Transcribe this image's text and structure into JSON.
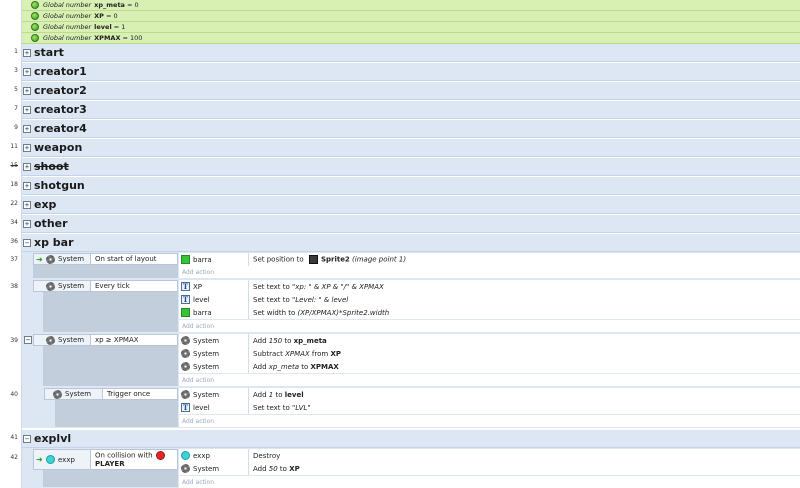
{
  "global_vars": [
    {
      "label": "Global number",
      "name": "xp_meta",
      "value": "= 0"
    },
    {
      "label": "Global number",
      "name": "XP",
      "value": "= 0"
    },
    {
      "label": "Global number",
      "name": "level",
      "value": "= 1"
    },
    {
      "label": "Global number",
      "name": "XPMAX",
      "value": "= 100"
    }
  ],
  "groups": [
    {
      "line": "1",
      "title": "start",
      "toggle": "+"
    },
    {
      "line": "3",
      "title": "creator1",
      "toggle": "+"
    },
    {
      "line": "5",
      "title": "creator2",
      "toggle": "+"
    },
    {
      "line": "7",
      "title": "creator3",
      "toggle": "+"
    },
    {
      "line": "9",
      "title": "creator4",
      "toggle": "+"
    },
    {
      "line": "11",
      "title": "weapon",
      "toggle": "+"
    },
    {
      "line": "15",
      "title": "shoot",
      "toggle": "+"
    },
    {
      "line": "18",
      "title": "shotgun",
      "toggle": "+"
    },
    {
      "line": "22",
      "title": "exp",
      "toggle": "+"
    },
    {
      "line": "34",
      "title": "other",
      "toggle": "+"
    },
    {
      "line": "36",
      "title": "xp bar",
      "toggle": "−"
    },
    {
      "line": "41",
      "title": "explvl",
      "toggle": "−"
    }
  ],
  "events": {
    "e37": {
      "line": "37",
      "obj": "System",
      "cond": "On start of layout",
      "a1": {
        "obj": "barra",
        "pre": "Set position to ",
        "obj2": "Sprite2",
        "post": " (image point 1)"
      },
      "add": "Add action"
    },
    "e38": {
      "line": "38",
      "obj": "System",
      "cond": "Every tick",
      "a1": {
        "obj": "XP",
        "pre": "Set text to ",
        "expr": "\"xp: \" & XP & \"/\" & XPMAX"
      },
      "a2": {
        "obj": "level",
        "pre": "Set text to ",
        "expr": "\"Level: \" & level"
      },
      "a3": {
        "obj": "barra",
        "pre": "Set width to ",
        "expr": "(XP/XPMAX)*Sprite2.width"
      },
      "add": "Add action"
    },
    "e39": {
      "line": "39",
      "toggle": "−",
      "obj": "System",
      "cond": "xp ≥ XPMAX",
      "a1": {
        "obj": "System",
        "pre": "Add ",
        "num": "150",
        "mid": " to ",
        "var": "xp_meta"
      },
      "a2": {
        "obj": "System",
        "pre": "Subtract ",
        "expr": "XPMAX",
        "mid": " from ",
        "var": "XP"
      },
      "a3": {
        "obj": "System",
        "pre": "Add ",
        "expr": "xp_meta",
        "mid": " to ",
        "var": "XPMAX"
      },
      "add": "Add action"
    },
    "e40": {
      "line": "40",
      "obj": "System",
      "cond": "Trigger once",
      "a1": {
        "obj": "System",
        "pre": "Add ",
        "num": "1",
        "mid": " to ",
        "var": "level"
      },
      "a2": {
        "obj": "level",
        "pre": "Set text to ",
        "expr": "\"LVL\""
      },
      "add": "Add action"
    },
    "e42": {
      "line": "42",
      "obj": "exxp",
      "cond": "On collision with",
      "cond_obj": "PLAYER",
      "a1": {
        "obj": "exxp",
        "pre": "Destroy"
      },
      "a2": {
        "obj": "System",
        "pre": "Add ",
        "num": "50",
        "mid": " to ",
        "var": "XP"
      },
      "add": "Add action"
    }
  },
  "colors": {
    "group_bg": "#dde7f3",
    "global_bg": "#d8f0b4",
    "accent_green": "#36c23a"
  }
}
